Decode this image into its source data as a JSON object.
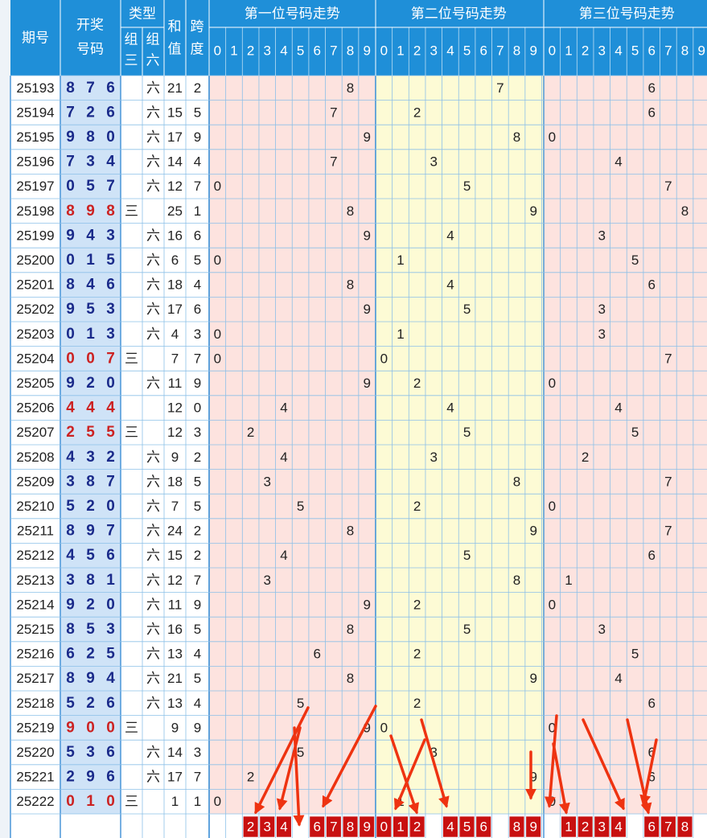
{
  "header": {
    "period": "期号",
    "draw": "开奖号码",
    "draw_line1": "开奖",
    "draw_line2": "号码",
    "type": "类型",
    "type_g3_a": "组",
    "type_g3_b": "三",
    "type_g6_a": "组",
    "type_g6_b": "六",
    "sum_a": "和",
    "sum_b": "值",
    "span_a": "跨",
    "span_b": "度",
    "pos1": "第一位号码走势",
    "pos2": "第二位号码走势",
    "pos3": "第三位号码走势",
    "digits": [
      "0",
      "1",
      "2",
      "3",
      "4",
      "5",
      "6",
      "7",
      "8",
      "9"
    ]
  },
  "chart_data": {
    "type": "table",
    "columns": [
      "期号",
      "开奖号码",
      "组三",
      "组六",
      "和值",
      "跨度",
      "第一位号码走势",
      "第二位号码走势",
      "第三位号码走势"
    ],
    "rows": [
      {
        "period": "25193",
        "d": [
          8,
          7,
          6
        ],
        "g3": "",
        "g6": "六",
        "sum": 21,
        "span": 2
      },
      {
        "period": "25194",
        "d": [
          7,
          2,
          6
        ],
        "g3": "",
        "g6": "六",
        "sum": 15,
        "span": 5
      },
      {
        "period": "25195",
        "d": [
          9,
          8,
          0
        ],
        "g3": "",
        "g6": "六",
        "sum": 17,
        "span": 9
      },
      {
        "period": "25196",
        "d": [
          7,
          3,
          4
        ],
        "g3": "",
        "g6": "六",
        "sum": 14,
        "span": 4
      },
      {
        "period": "25197",
        "d": [
          0,
          5,
          7
        ],
        "g3": "",
        "g6": "六",
        "sum": 12,
        "span": 7
      },
      {
        "period": "25198",
        "d": [
          8,
          9,
          8
        ],
        "g3": "三",
        "g6": "",
        "sum": 25,
        "span": 1
      },
      {
        "period": "25199",
        "d": [
          9,
          4,
          3
        ],
        "g3": "",
        "g6": "六",
        "sum": 16,
        "span": 6
      },
      {
        "period": "25200",
        "d": [
          0,
          1,
          5
        ],
        "g3": "",
        "g6": "六",
        "sum": 6,
        "span": 5
      },
      {
        "period": "25201",
        "d": [
          8,
          4,
          6
        ],
        "g3": "",
        "g6": "六",
        "sum": 18,
        "span": 4
      },
      {
        "period": "25202",
        "d": [
          9,
          5,
          3
        ],
        "g3": "",
        "g6": "六",
        "sum": 17,
        "span": 6
      },
      {
        "period": "25203",
        "d": [
          0,
          1,
          3
        ],
        "g3": "",
        "g6": "六",
        "sum": 4,
        "span": 3
      },
      {
        "period": "25204",
        "d": [
          0,
          0,
          7
        ],
        "g3": "三",
        "g6": "",
        "sum": 7,
        "span": 7
      },
      {
        "period": "25205",
        "d": [
          9,
          2,
          0
        ],
        "g3": "",
        "g6": "六",
        "sum": 11,
        "span": 9
      },
      {
        "period": "25206",
        "d": [
          4,
          4,
          4
        ],
        "g3": "",
        "g6": "",
        "sum": 12,
        "span": 0
      },
      {
        "period": "25207",
        "d": [
          2,
          5,
          5
        ],
        "g3": "三",
        "g6": "",
        "sum": 12,
        "span": 3
      },
      {
        "period": "25208",
        "d": [
          4,
          3,
          2
        ],
        "g3": "",
        "g6": "六",
        "sum": 9,
        "span": 2
      },
      {
        "period": "25209",
        "d": [
          3,
          8,
          7
        ],
        "g3": "",
        "g6": "六",
        "sum": 18,
        "span": 5
      },
      {
        "period": "25210",
        "d": [
          5,
          2,
          0
        ],
        "g3": "",
        "g6": "六",
        "sum": 7,
        "span": 5
      },
      {
        "period": "25211",
        "d": [
          8,
          9,
          7
        ],
        "g3": "",
        "g6": "六",
        "sum": 24,
        "span": 2
      },
      {
        "period": "25212",
        "d": [
          4,
          5,
          6
        ],
        "g3": "",
        "g6": "六",
        "sum": 15,
        "span": 2
      },
      {
        "period": "25213",
        "d": [
          3,
          8,
          1
        ],
        "g3": "",
        "g6": "六",
        "sum": 12,
        "span": 7
      },
      {
        "period": "25214",
        "d": [
          9,
          2,
          0
        ],
        "g3": "",
        "g6": "六",
        "sum": 11,
        "span": 9
      },
      {
        "period": "25215",
        "d": [
          8,
          5,
          3
        ],
        "g3": "",
        "g6": "六",
        "sum": 16,
        "span": 5
      },
      {
        "period": "25216",
        "d": [
          6,
          2,
          5
        ],
        "g3": "",
        "g6": "六",
        "sum": 13,
        "span": 4
      },
      {
        "period": "25217",
        "d": [
          8,
          9,
          4
        ],
        "g3": "",
        "g6": "六",
        "sum": 21,
        "span": 5
      },
      {
        "period": "25218",
        "d": [
          5,
          2,
          6
        ],
        "g3": "",
        "g6": "六",
        "sum": 13,
        "span": 4
      },
      {
        "period": "25219",
        "d": [
          9,
          0,
          0
        ],
        "g3": "三",
        "g6": "",
        "sum": 9,
        "span": 9
      },
      {
        "period": "25220",
        "d": [
          5,
          3,
          6
        ],
        "g3": "",
        "g6": "六",
        "sum": 14,
        "span": 3
      },
      {
        "period": "25221",
        "d": [
          2,
          9,
          6
        ],
        "g3": "",
        "g6": "六",
        "sum": 17,
        "span": 7
      },
      {
        "period": "25222",
        "d": [
          0,
          1,
          0
        ],
        "g3": "三",
        "g6": "",
        "sum": 1,
        "span": 1
      }
    ],
    "forecast": [
      [
        2,
        3,
        4,
        6,
        7,
        8,
        9
      ],
      [
        0,
        1,
        2,
        4,
        5,
        6,
        8,
        9
      ],
      [
        1,
        2,
        3,
        4,
        6,
        7,
        8
      ]
    ],
    "colors": {
      "header_bg": "#1f8fd8",
      "header_text": "#ffffff",
      "g3_digit": "#cc2222",
      "g6_digit": "#1a2a8a",
      "draw_bg": "#cfe3f7",
      "zone1_bg": "#fde3df",
      "zone2_bg": "#fdfbd5",
      "zone3_bg": "#fde3df",
      "grid": "#8cc0e8",
      "forecast_bg": "#c81010",
      "arrow": "#ee3311"
    }
  }
}
